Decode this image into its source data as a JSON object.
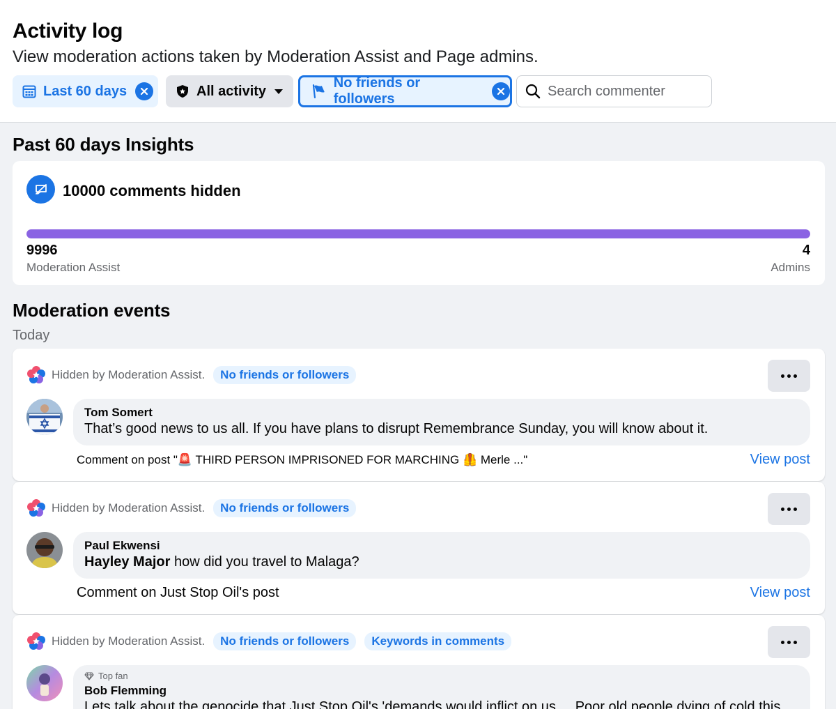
{
  "header": {
    "title": "Activity log",
    "subtitle": "View moderation actions taken by Moderation Assist and Page admins."
  },
  "filters": {
    "date_label": "Last 60 days",
    "activity_label": "All activity",
    "friends_label": "No friends or followers",
    "search_placeholder": "Search commenter"
  },
  "insights": {
    "title": "Past 60 days Insights",
    "hidden_text": "10000 comments hidden",
    "moderation_assist_count": "9996",
    "moderation_assist_label": "Moderation Assist",
    "admins_count": "4",
    "admins_label": "Admins",
    "moderation_assist_fraction": 0.9996
  },
  "events": {
    "title": "Moderation events",
    "group_label": "Today",
    "items": [
      {
        "hidden_by": "Hidden by Moderation Assist.",
        "tags": [
          "No friends or followers"
        ],
        "commenter": "Tom Somert",
        "comment": "That’s good news to us all. If you have plans to disrupt Remembrance Sunday, you will know about it.",
        "context": "Comment on post \"🚨 THIRD PERSON IMPRISONED FOR MARCHING 🦺 Merle ...\"",
        "view_post": "View post"
      },
      {
        "hidden_by": "Hidden by Moderation Assist.",
        "tags": [
          "No friends or followers"
        ],
        "commenter": "Paul Ekwensi",
        "mention": "Hayley Major",
        "comment": "how did you travel to Malaga?",
        "context": "Comment on Just Stop Oil's post",
        "view_post": "View post"
      },
      {
        "hidden_by": "Hidden by Moderation Assist.",
        "tags": [
          "No friends or followers",
          "Keywords in comments"
        ],
        "badge": "Top fan",
        "commenter": "Bob Flemming",
        "comment": "Lets talk about the genocide that Just Stop Oil's 'demands would inflict on us.... Poor old people dying of cold this"
      }
    ]
  },
  "colors": {
    "accent": "#1b74e4",
    "bar": "#8a63e3",
    "chip_bg": "#e7f3ff"
  }
}
